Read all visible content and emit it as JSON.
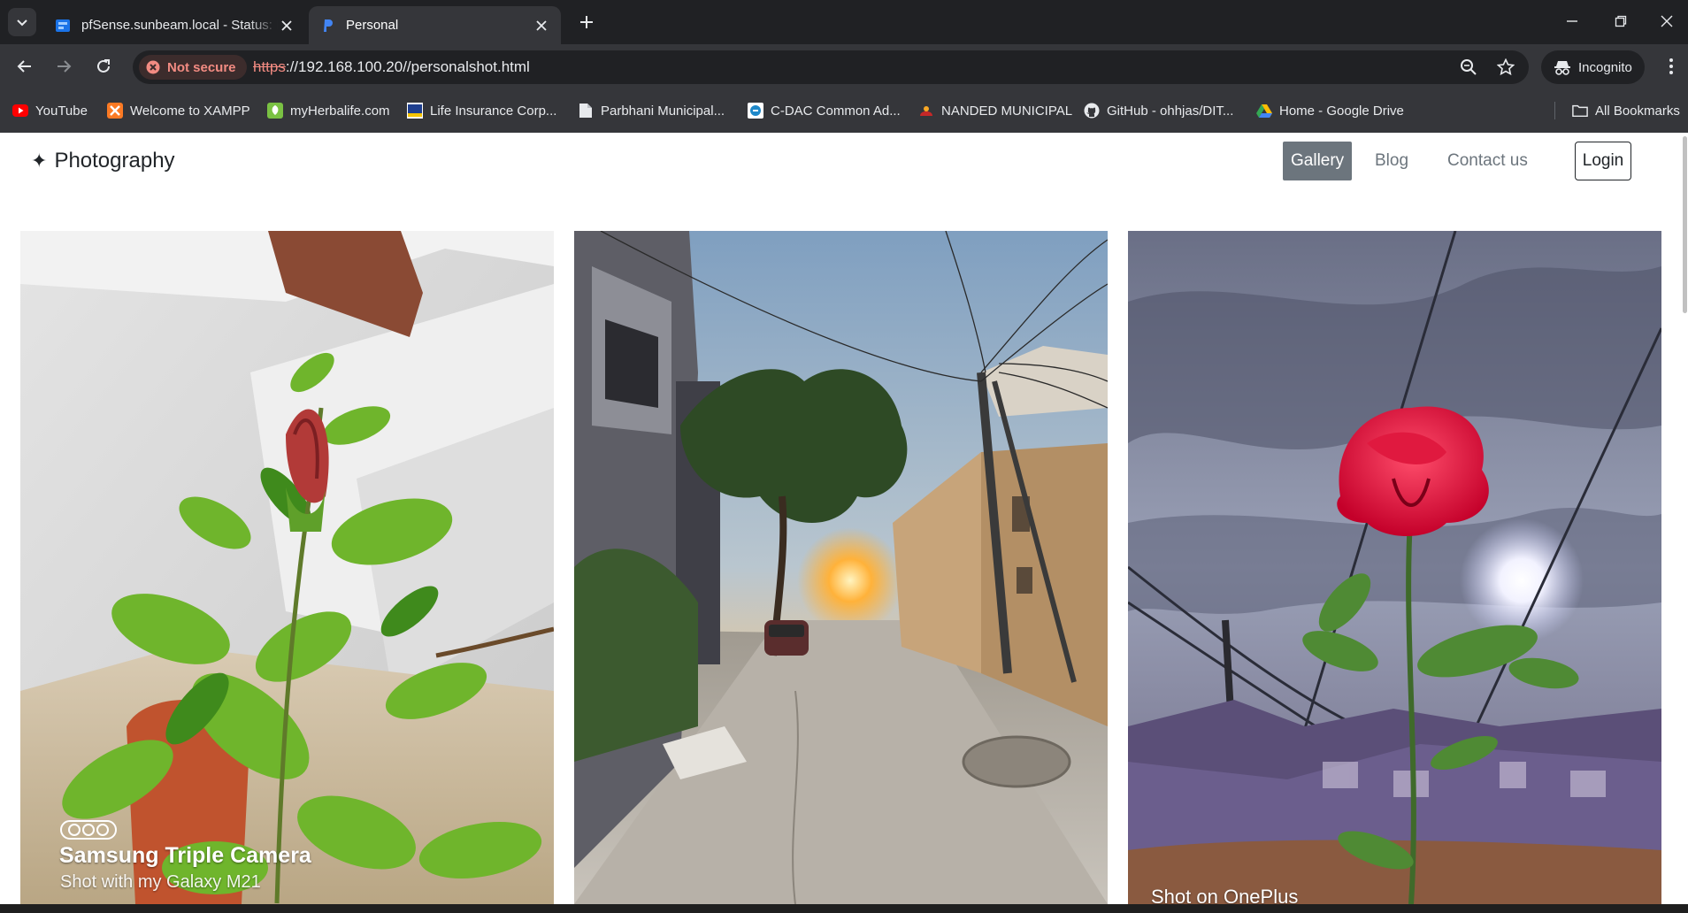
{
  "browser": {
    "tabs": [
      {
        "title": "pfSense.sunbeam.local - Status: D",
        "active": false
      },
      {
        "title": "Personal",
        "active": true
      }
    ],
    "address": {
      "security_label": "Not secure",
      "url_scheme": "https",
      "url_rest": "://192.168.100.20//personalshot.html"
    },
    "profile_label": "Incognito",
    "bookmarks": [
      {
        "label": "YouTube",
        "icon": "youtube-icon"
      },
      {
        "label": "Welcome to XAMPP",
        "icon": "xampp-icon"
      },
      {
        "label": "myHerbalife.com",
        "icon": "herbalife-icon"
      },
      {
        "label": "Life Insurance Corp...",
        "icon": "lic-icon"
      },
      {
        "label": "Parbhani Municipal...",
        "icon": "document-icon"
      },
      {
        "label": "C-DAC Common Ad...",
        "icon": "cdac-icon"
      },
      {
        "label": "NANDED MUNICIPAL",
        "icon": "municipal-icon"
      },
      {
        "label": "GitHub - ohhjas/DIT...",
        "icon": "github-icon"
      },
      {
        "label": "Home - Google Drive",
        "icon": "google-drive-icon"
      }
    ],
    "all_bookmarks_label": "All Bookmarks"
  },
  "site": {
    "brand_icon": "✦",
    "brand": "Photography",
    "nav": [
      {
        "label": "Gallery",
        "active": true
      },
      {
        "label": "Blog",
        "active": false
      },
      {
        "label": "Contact us",
        "active": false
      }
    ],
    "login_label": "Login"
  },
  "gallery": [
    {
      "subject": "hibiscus-bud",
      "watermark_title": "Samsung Triple Camera",
      "watermark_sub": "Shot with my Galaxy M21"
    },
    {
      "subject": "street-sunset",
      "watermark_title": "",
      "watermark_sub": ""
    },
    {
      "subject": "red-rose",
      "watermark_title": "",
      "watermark_sub": "Shot on OnePlus"
    }
  ],
  "colors": {
    "chrome_dark": "#202124",
    "chrome_mid": "#35363a",
    "not_secure_red": "#f28b82",
    "nav_active_bg": "#6c757d"
  }
}
